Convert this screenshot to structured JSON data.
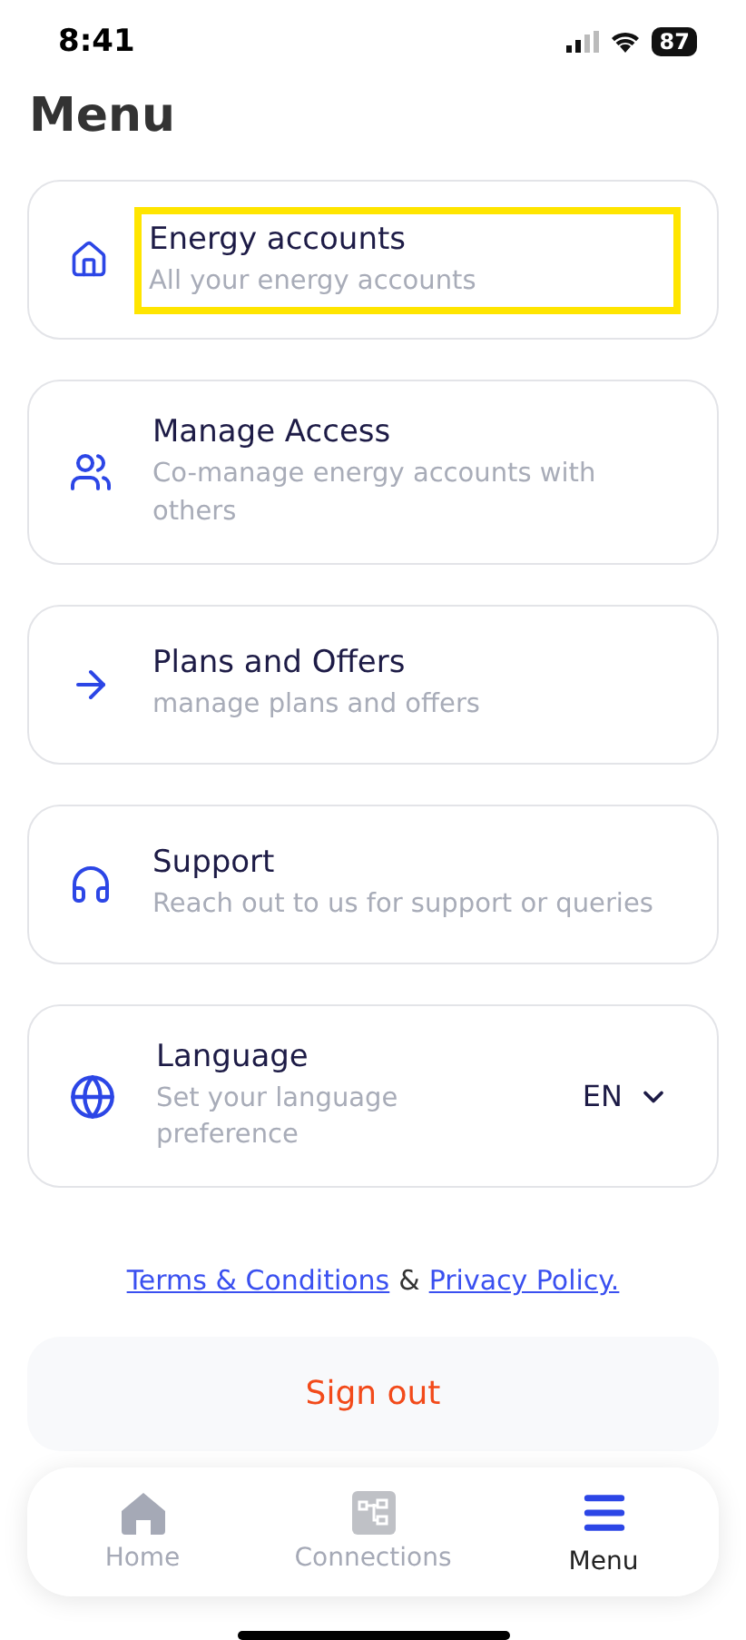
{
  "status_bar": {
    "time": "8:41",
    "battery": "87"
  },
  "title": "Menu",
  "items": [
    {
      "kind": "accounts",
      "title": "Energy accounts",
      "subtitle": "All your energy accounts",
      "highlighted": true
    },
    {
      "kind": "access",
      "title": "Manage Access",
      "subtitle": "Co-manage energy accounts with others",
      "highlighted": false
    },
    {
      "kind": "plans",
      "title": "Plans and Offers",
      "subtitle": "manage plans and offers",
      "highlighted": false
    },
    {
      "kind": "support",
      "title": "Support",
      "subtitle": "Reach out to us for support or queries",
      "highlighted": false
    },
    {
      "kind": "language",
      "title": "Language",
      "subtitle": "Set your language preference",
      "highlighted": false,
      "value": "EN"
    }
  ],
  "legal": {
    "terms": "Terms & Conditions",
    "joiner": "&",
    "privacy": "Privacy Policy."
  },
  "sign_out": "Sign out",
  "tabs": [
    {
      "kind": "home",
      "label": "Home",
      "selected": false
    },
    {
      "kind": "connections",
      "label": "Connections",
      "selected": false
    },
    {
      "kind": "menu",
      "label": "Menu",
      "selected": true
    }
  ]
}
